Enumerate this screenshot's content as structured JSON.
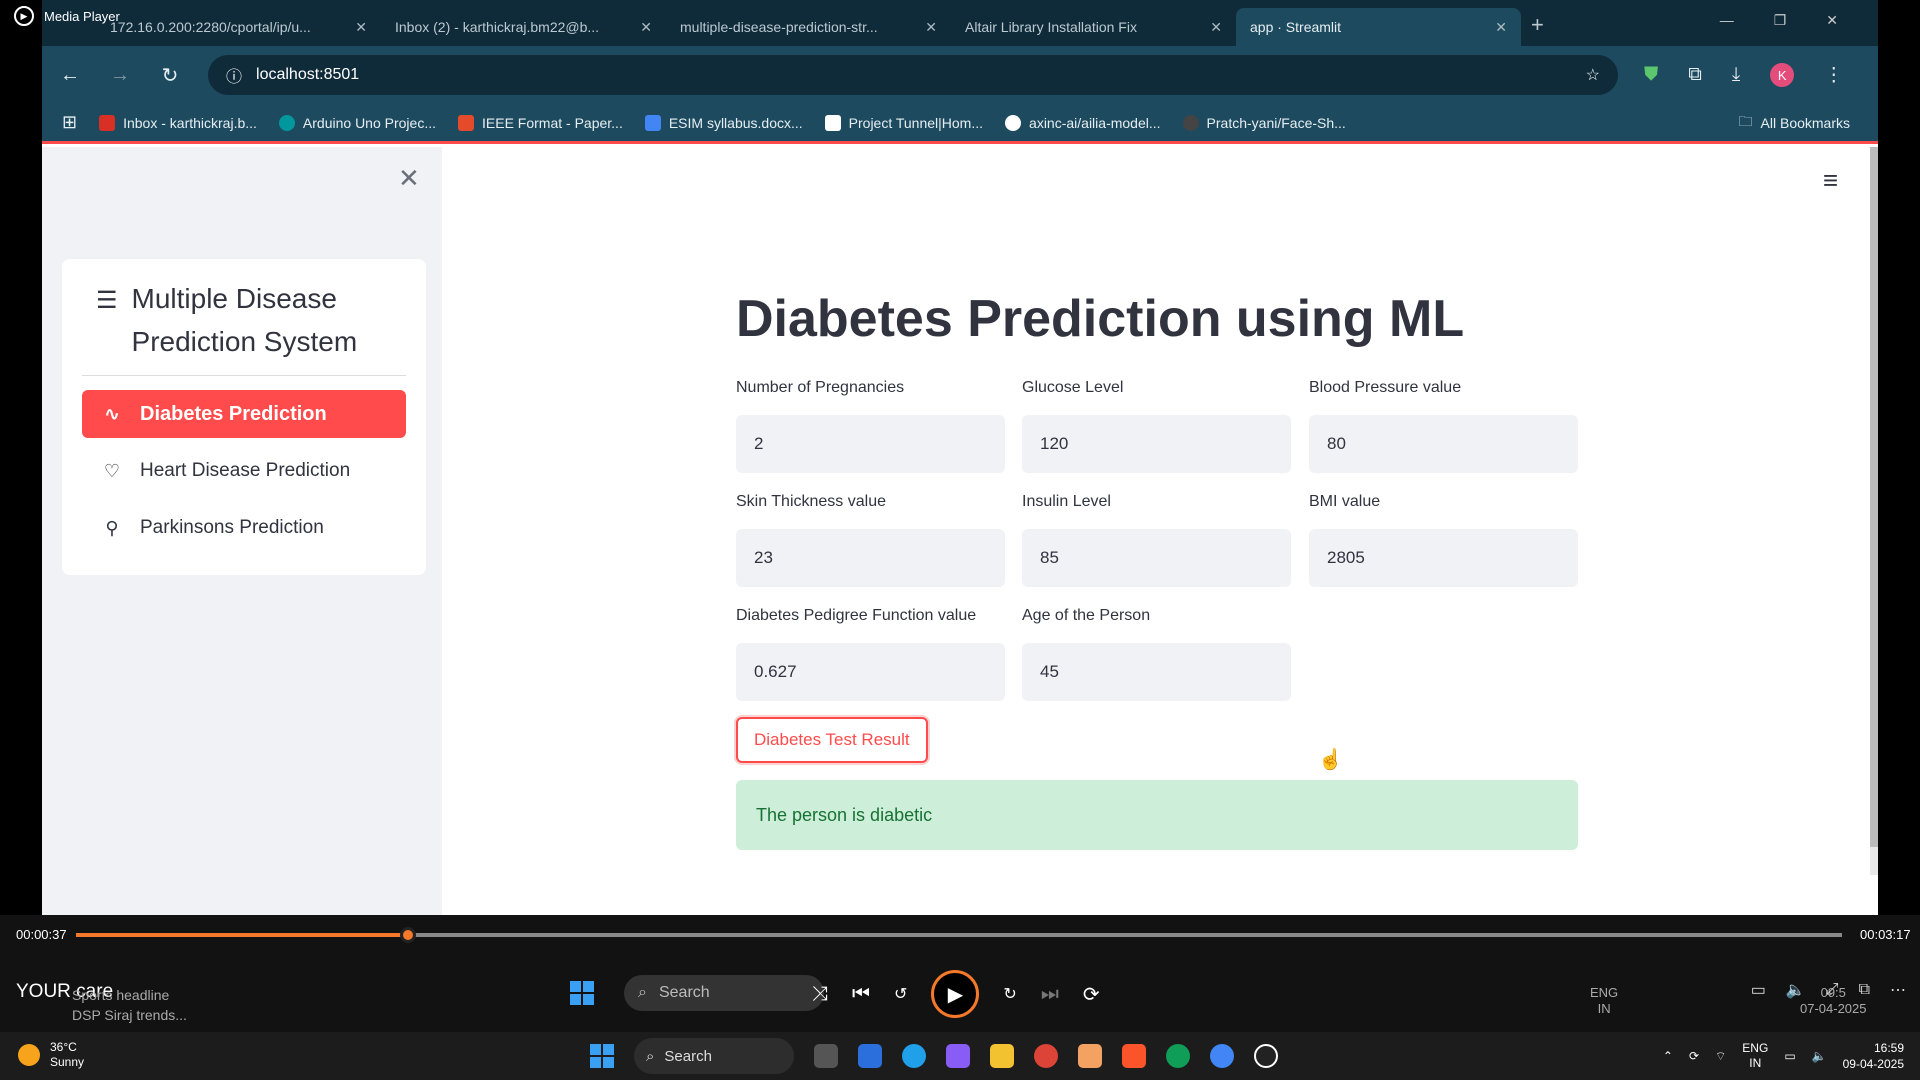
{
  "media_player": {
    "title": "Media Player",
    "elapsed": "00:00:37",
    "total": "00:03:17",
    "progress": 0.188,
    "overlay_text": "YOUR care",
    "news_title": "Sports headline",
    "news_sub": "DSP Siraj trends...",
    "ghost_search": "Search",
    "ghost_lang": "ENG",
    "ghost_region": "IN",
    "ghost_time": "09:5",
    "ghost_date": "07-04-2025"
  },
  "browser": {
    "tabs": [
      {
        "label": "172.16.0.200:2280/cportal/ip/u..."
      },
      {
        "label": "Inbox (2) - karthickraj.bm22@b..."
      },
      {
        "label": "multiple-disease-prediction-str..."
      },
      {
        "label": "Altair Library Installation Fix"
      },
      {
        "label": "app · Streamlit"
      }
    ],
    "url": "localhost:8501",
    "profile_initial": "K",
    "bookmarks": [
      {
        "label": "Inbox - karthickraj.b...",
        "color": "#d93025"
      },
      {
        "label": "Arduino Uno Projec...",
        "color": "#00979d"
      },
      {
        "label": "IEEE Format - Paper...",
        "color": "#e34b2b"
      },
      {
        "label": "ESIM syllabus.docx...",
        "color": "#4285f4"
      },
      {
        "label": "Project Tunnel|Hom...",
        "color": "#ffffff"
      },
      {
        "label": "axinc-ai/ailia-model...",
        "color": "#ffffff"
      },
      {
        "label": "Pratch-yani/Face-Sh...",
        "color": "#444444"
      }
    ],
    "all_bookmarks": "All Bookmarks"
  },
  "sidebar": {
    "title": "Multiple Disease Prediction System",
    "items": [
      {
        "label": "Diabetes Prediction",
        "icon": "activity-icon",
        "selected": true
      },
      {
        "label": "Heart Disease Prediction",
        "icon": "heart-icon",
        "selected": false
      },
      {
        "label": "Parkinsons Prediction",
        "icon": "person-icon",
        "selected": false
      }
    ]
  },
  "main": {
    "title": "Diabetes Prediction using ML",
    "fields": [
      {
        "label": "Number of Pregnancies",
        "value": "2"
      },
      {
        "label": "Glucose Level",
        "value": "120"
      },
      {
        "label": "Blood Pressure value",
        "value": "80"
      },
      {
        "label": "Skin Thickness value",
        "value": "23"
      },
      {
        "label": "Insulin Level",
        "value": "85"
      },
      {
        "label": "BMI value",
        "value": "2805"
      },
      {
        "label": "Diabetes Pedigree Function value",
        "value": "0.627"
      },
      {
        "label": "Age of the Person",
        "value": "45"
      }
    ],
    "button_label": "Diabetes Test Result",
    "result": "The person is diabetic"
  },
  "taskbar": {
    "temperature": "36°C",
    "weather": "Sunny",
    "search": "Search",
    "lang": "ENG",
    "region": "IN",
    "time": "16:59",
    "date": "09-04-2025"
  },
  "colors": {
    "accent": "#ff4b4b",
    "success_bg": "#cdeed9",
    "success_text": "#177233",
    "progress": "#f5792a"
  }
}
